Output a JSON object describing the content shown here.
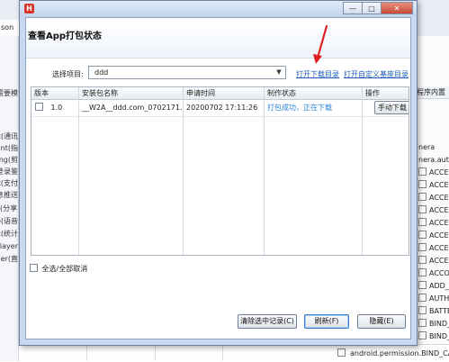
{
  "app": {
    "icon_letter": "H",
    "dialog_title": "查看App打包状态",
    "window_buttons": [
      "—",
      "□",
      "✕"
    ]
  },
  "background": {
    "tab_label": "son",
    "left_rows": [
      "需要模",
      "t(通讯",
      "print(指",
      "ging(剪",
      "登录鉴",
      "nt(支付",
      "消息推送",
      "分享)",
      "b(语音",
      "c(统计",
      "layer(",
      "sher(直"
    ],
    "right_header": "程序内置",
    "right_rows": [
      "nera",
      "nera.aut",
      "ACCESS_",
      "ACCESS_",
      "ACCESS_",
      "ACCESS_",
      "ACCESS_",
      "ACCESS_",
      "ACCESS_",
      "ACCESS_",
      "ACCOUN",
      "ADD_VOI",
      "AUTHEN",
      "BATTERY",
      "BIND_AC",
      "BIND_AP"
    ],
    "bottom_row": "android.permission.BIND_CA"
  },
  "project": {
    "label": "选择项目:",
    "selected": "ddd",
    "open_download_dir": "打开下载目录",
    "open_custom_base_dir": "打开自定义基座目录"
  },
  "table": {
    "headers": {
      "version": "版本",
      "package": "安装包名称",
      "time": "申请时间",
      "status": "制作状态",
      "action": "操作"
    },
    "rows": [
      {
        "version": "1.0",
        "package": "__W2A__ddd.com_0702171...",
        "time": "20200702 17:11:26",
        "status": "打包成功，正在下载",
        "action": "手动下载"
      }
    ]
  },
  "select_all_label": "全选/全部取消",
  "buttons": {
    "clear": "清除选中记录(C)",
    "refresh": "刷新(F)",
    "hide": "隐藏(E)"
  },
  "colors": {
    "annotation_arrow": "#e02020",
    "link": "#1f5fb7",
    "status": "#2b7fd6",
    "app_icon": "#d9362b"
  }
}
